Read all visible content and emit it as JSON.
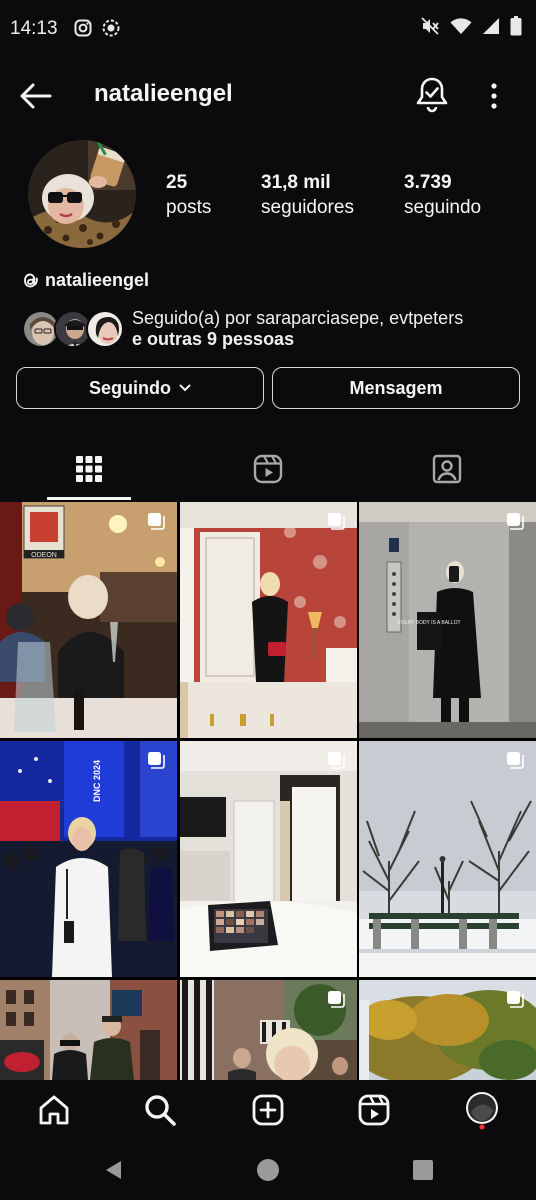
{
  "status_bar": {
    "time": "14:13"
  },
  "header": {
    "username": "natalieengel"
  },
  "profile": {
    "stats": [
      {
        "value": "25",
        "label": "posts"
      },
      {
        "value": "31,8 mil",
        "label": "seguidores"
      },
      {
        "value": "3.739",
        "label": "seguindo"
      }
    ],
    "threads_handle": "natalieengel",
    "followed_by_line1": "Seguido(a) por saraparciasepe, evtpeters",
    "followed_by_line2": "e outras 9 pessoas",
    "following_button": "Seguindo",
    "message_button": "Mensagem"
  },
  "tabs": [
    "grid-icon",
    "reels-icon",
    "tagged-icon"
  ],
  "grid_posts": [
    {
      "scene": "restaurant",
      "multi": true,
      "sign": "ODEON"
    },
    {
      "scene": "red-room-mirror",
      "multi": true
    },
    {
      "scene": "elevator-mirror",
      "multi": true,
      "bag_text": "EVERY BODY IS A BALLOT"
    },
    {
      "scene": "dnc-convention",
      "multi": true,
      "banner": "DNC 2024"
    },
    {
      "scene": "bedroom-laptop",
      "multi": true
    },
    {
      "scene": "snowy-park",
      "multi": true
    },
    {
      "scene": "city-street",
      "multi": false
    },
    {
      "scene": "street-selfie",
      "multi": true
    },
    {
      "scene": "autumn-trees",
      "multi": true
    }
  ],
  "bottom_nav": [
    "home-icon",
    "search-icon",
    "create-icon",
    "reels-icon",
    "profile-avatar"
  ],
  "colors": {
    "background": "#000000",
    "surface": "#0b0b0d",
    "text": "#f5f5f5",
    "notification_dot": "#ff3040"
  }
}
